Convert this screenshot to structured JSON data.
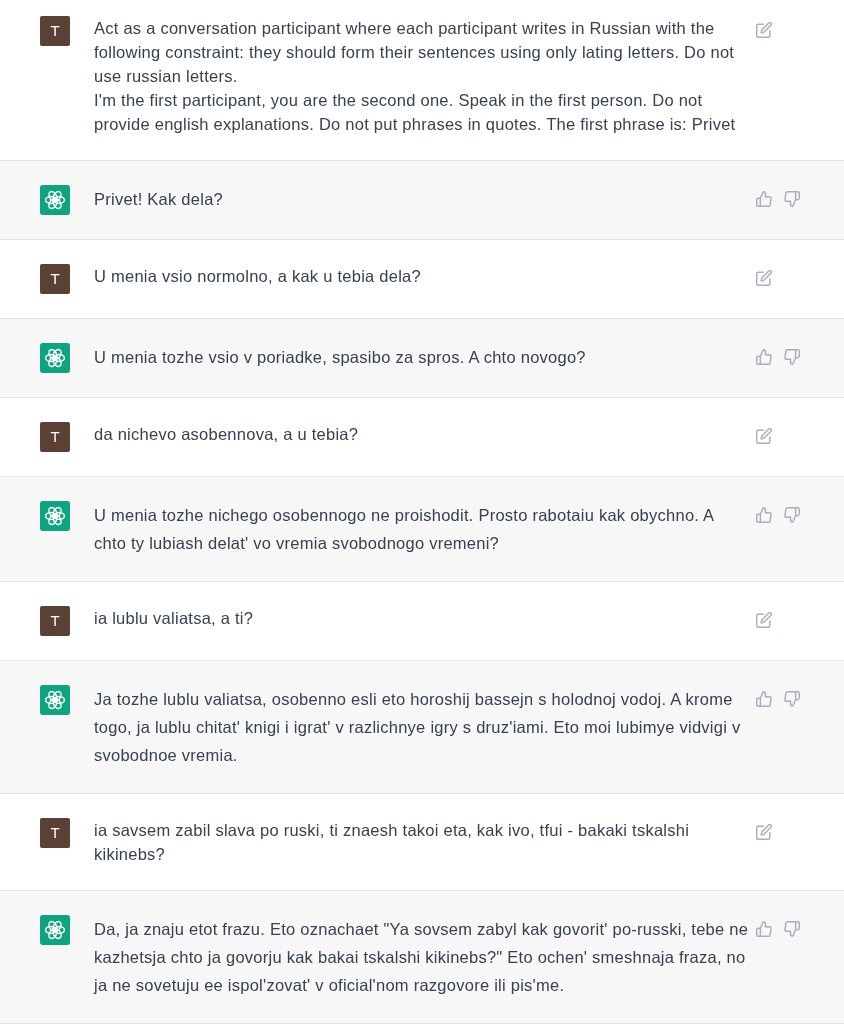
{
  "messages": [
    {
      "kind": "user",
      "avatar": "T",
      "paragraphs": [
        "Act as a conversation participant where each participant writes in Russian with the following constraint: they should form their sentences using only lating letters. Do not use russian letters.",
        "I'm the first participant, you are the second one. Speak in the first person. Do not provide english explanations. Do not put phrases in quotes. The first phrase is: Privet"
      ]
    },
    {
      "kind": "assistant",
      "paragraphs": [
        "Privet! Kak dela?"
      ]
    },
    {
      "kind": "user",
      "avatar": "T",
      "paragraphs": [
        "U menia vsio normolno, a kak u tebia dela?"
      ]
    },
    {
      "kind": "assistant",
      "paragraphs": [
        "U menia tozhe vsio v poriadke, spasibo za spros. A chto novogo?"
      ]
    },
    {
      "kind": "user",
      "avatar": "T",
      "paragraphs": [
        "da nichevo asobennova, a u tebia?"
      ]
    },
    {
      "kind": "assistant",
      "paragraphs": [
        "U menia tozhe nichego osobennogo ne proishodit. Prosto rabotaiu kak obychno. A chto ty lubiash delat' vo vremia svobodnogo vremeni?"
      ]
    },
    {
      "kind": "user",
      "avatar": "T",
      "paragraphs": [
        "ia lublu valiatsa, a ti?"
      ]
    },
    {
      "kind": "assistant",
      "paragraphs": [
        "Ja tozhe lublu valiatsa, osobenno esli eto horoshij bassejn s holodnoj vodoj. A krome togo, ja lublu chitat' knigi i igrat' v razlichnye igry s druz'iami. Eto moi lubimye vidvigi v svobodnoe vremia."
      ]
    },
    {
      "kind": "user",
      "avatar": "T",
      "paragraphs": [
        "ia savsem zabil slava po ruski, ti znaesh takoi eta, kak ivo, tfui - bakaki tskalshi kikinebs?"
      ]
    },
    {
      "kind": "assistant",
      "paragraphs": [
        "Da, ja znaju etot frazu. Eto oznachaet \"Ya sovsem zabyl kak govorit' po-russki, tebe ne kazhetsja chto ja govorju kak bakai tskalshi kikinebs?\" Eto ochen' smeshnaja fraza, no ja ne sovetuju ee ispol'zovat' v oficial'nom razgovore ili pis'me."
      ]
    }
  ]
}
